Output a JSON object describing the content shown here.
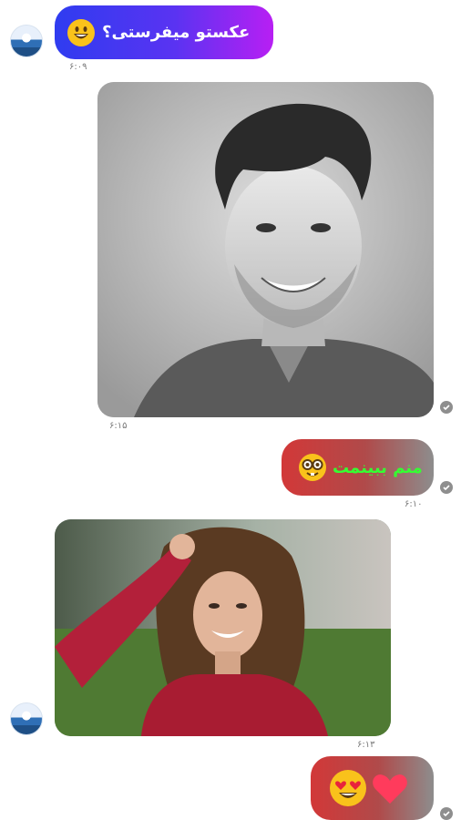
{
  "messages": [
    {
      "text": "عکستو میفرستی؟",
      "time": "۶:۰۹"
    },
    {
      "time": "۶:۱۵"
    },
    {
      "text": "منم ببینمت",
      "time": "۶:۱۰"
    },
    {
      "time": "۶:۱۳"
    },
    {
      "time": ""
    }
  ],
  "icons": {
    "grin": "grinning-face-emoji",
    "nerd": "nerd-face-emoji",
    "heart_eyes": "heart-eyes-emoji",
    "heart": "red-heart-emoji",
    "check": "check-circle-icon"
  },
  "colors": {
    "bubble1_from": "#2f3cf0",
    "bubble1_to": "#b81ff3",
    "bubble1_text": "#ffffff",
    "sent_from": "#cf3a3a",
    "sent_to": "#8a8a8a",
    "sent_text": "#35ff32",
    "check": "#8e8e8e"
  }
}
